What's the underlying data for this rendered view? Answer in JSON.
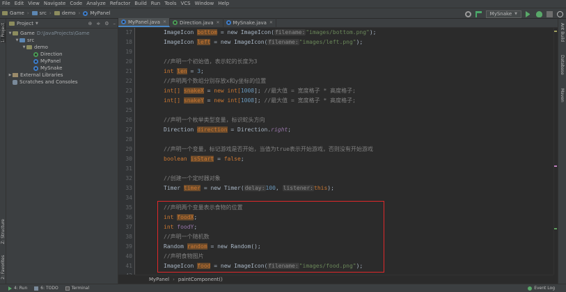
{
  "menu": [
    "File",
    "Edit",
    "View",
    "Navigate",
    "Code",
    "Analyze",
    "Refactor",
    "Build",
    "Run",
    "Tools",
    "VCS",
    "Window",
    "Help"
  ],
  "navbar": {
    "crumbs": [
      "Game",
      "src",
      "demo",
      "MyPanel"
    ],
    "run_config": "MySnake"
  },
  "sidebar_left": {
    "project_tab": "1: Project",
    "structure_tab": "Z: Structure",
    "favorites_tab": "2: Favorites"
  },
  "sidebar_right": {
    "ant": "Ant Build",
    "database": "Database",
    "maven": "Maven"
  },
  "project_panel": {
    "title": "Project",
    "tree": [
      {
        "label": "Game",
        "path": "D:\\JavaProjects\\Game"
      },
      {
        "label": "src"
      },
      {
        "label": "demo"
      },
      {
        "label": "Direction"
      },
      {
        "label": "MyPanel"
      },
      {
        "label": "MySnake"
      },
      {
        "label": "External Libraries"
      },
      {
        "label": "Scratches and Consoles"
      }
    ]
  },
  "tabs": [
    "MyPanel.java",
    "Direction.java",
    "MySnake.java"
  ],
  "line_numbers": [
    "17",
    "18",
    "19",
    "20",
    "21",
    "22",
    "23",
    "24",
    "25",
    "26",
    "27",
    "28",
    "29",
    "30",
    "31",
    "32",
    "33",
    "34",
    "35",
    "36",
    "37",
    "38",
    "39",
    "40",
    "41",
    "42"
  ],
  "code": {
    "l17": {
      "type": "ImageIcon",
      "name": "bottom",
      "mid": " = new ImageIcon(",
      "hint": "filename:",
      "str": "\"images/bottom.png\"",
      "end": ");"
    },
    "l18": {
      "type": "ImageIcon",
      "name": "left",
      "mid": " = new ImageIcon(",
      "hint": "filename:",
      "str": "\"images/left.png\"",
      "end": ");"
    },
    "l20": "//声明一个初始值，表示蛇的长度为3",
    "l21": {
      "kw": "int",
      "name": "len",
      "mid": " = ",
      "num": "3",
      "end": ";"
    },
    "l22": "//声明两个数组分别存放x和y坐标的位置",
    "l23": {
      "type": "int[]",
      "name": "snakeX",
      "mid": " = ",
      "kw": "new",
      "mid2": " int[",
      "num": "1008",
      "end": "]; ",
      "comment": "//最大值 = 宽度格子 * 高度格子;"
    },
    "l24": {
      "type": "int[]",
      "name": "snakeY",
      "mid": " = ",
      "kw": "new",
      "mid2": " int[",
      "num": "1008",
      "end": "]; ",
      "comment": "//最大值 = 宽度格子 * 高度格子;"
    },
    "l26": "//声明一个枚举类型变量，标识蛇头方向",
    "l27": {
      "type": "Direction",
      "name": "direction",
      "mid": " = Direction.",
      "field": "right",
      "end": ";"
    },
    "l29": "//声明一个变量，标记游戏是否开始，当值为true表示开始游戏，否则没有开始游戏",
    "l30": {
      "kw": "boolean",
      "name": "isStart",
      "mid": " = ",
      "kw2": "false",
      "end": ";"
    },
    "l32": "//创建一个定时器对象",
    "l33": {
      "type": "Timer",
      "name": "timer",
      "mid": " = new Timer(",
      "hint1": "delay:",
      "num": "100",
      "sep": ", ",
      "hint2": "listener:",
      "kw": "this",
      "end": ");"
    },
    "l35": "//声明两个变量表示食物的位置",
    "l36": {
      "kw": "int",
      "name": "foodX",
      "end": ";"
    },
    "l37": {
      "kw": "int",
      "name": "foodY",
      "end": ";"
    },
    "l38": "//声明一个随机数",
    "l39": {
      "type": "Random",
      "name": "random",
      "mid": " = new Random();"
    },
    "l40": "//声明食物图片",
    "l41": {
      "type": "ImageIcon",
      "name": "food",
      "mid": " = new ImageIcon(",
      "hint": "filename:",
      "str": "\"images/food.png\"",
      "end": ");"
    }
  },
  "editor_breadcrumb": [
    "MyPanel",
    "paintComponent()"
  ],
  "statusbar": {
    "run": "4: Run",
    "todo": "6: TODO",
    "terminal": "Terminal",
    "event_log": "Event Log"
  },
  "colors": {
    "highlight_box": "#e0282a",
    "keyword": "#cc7832",
    "comment": "#808080",
    "string": "#6a8759",
    "number": "#6897bb"
  }
}
